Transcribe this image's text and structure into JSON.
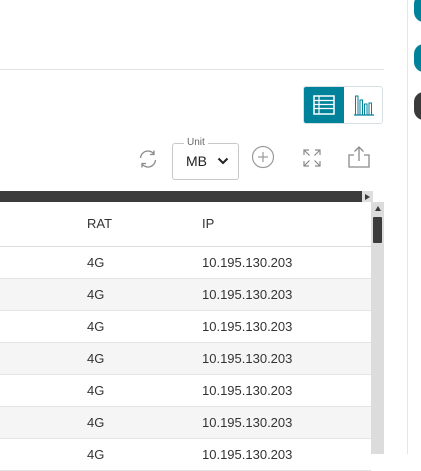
{
  "toolbar": {
    "view_modes": [
      "table",
      "chart"
    ],
    "active_view": "table",
    "unit": {
      "legend": "Unit",
      "value": "MB"
    },
    "accent_color": "#00829b"
  },
  "table": {
    "columns": [
      "RAT",
      "IP"
    ],
    "rows": [
      [
        "4G",
        "10.195.130.203"
      ],
      [
        "4G",
        "10.195.130.203"
      ],
      [
        "4G",
        "10.195.130.203"
      ],
      [
        "4G",
        "10.195.130.203"
      ],
      [
        "4G",
        "10.195.130.203"
      ],
      [
        "4G",
        "10.195.130.203"
      ],
      [
        "4G",
        "10.195.130.203"
      ]
    ]
  },
  "icons": [
    "table-view-icon",
    "chart-view-icon",
    "refresh-icon",
    "chevron-down-icon",
    "add-circle-icon",
    "fullscreen-icon",
    "export-icon"
  ]
}
